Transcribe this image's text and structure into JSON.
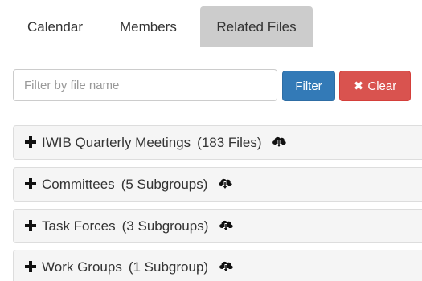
{
  "tabs": [
    {
      "label": "Calendar"
    },
    {
      "label": "Members"
    },
    {
      "label": "Related Files",
      "active": true
    }
  ],
  "filter": {
    "placeholder": "Filter by file name",
    "value": "",
    "filter_button": "Filter",
    "clear_button": "Clear",
    "clear_icon": "x-icon"
  },
  "groups": [
    {
      "name": "IWIB Quarterly Meetings",
      "count": "(183 Files)",
      "expand_icon": "plus-icon",
      "action_icon": "cloud-download-icon"
    },
    {
      "name": "Committees",
      "count": "(5 Subgroups)",
      "expand_icon": "plus-icon",
      "action_icon": "cloud-download-icon"
    },
    {
      "name": "Task Forces",
      "count": "(3 Subgroups)",
      "expand_icon": "plus-icon",
      "action_icon": "cloud-download-icon"
    },
    {
      "name": "Work Groups",
      "count": "(1 Subgroup)",
      "expand_icon": "plus-icon",
      "action_icon": "cloud-download-icon"
    }
  ],
  "colors": {
    "active_tab_bg": "#cccccc",
    "filter_button": "#337ab7",
    "clear_button": "#d9534f",
    "panel_bg": "#f5f5f5"
  }
}
